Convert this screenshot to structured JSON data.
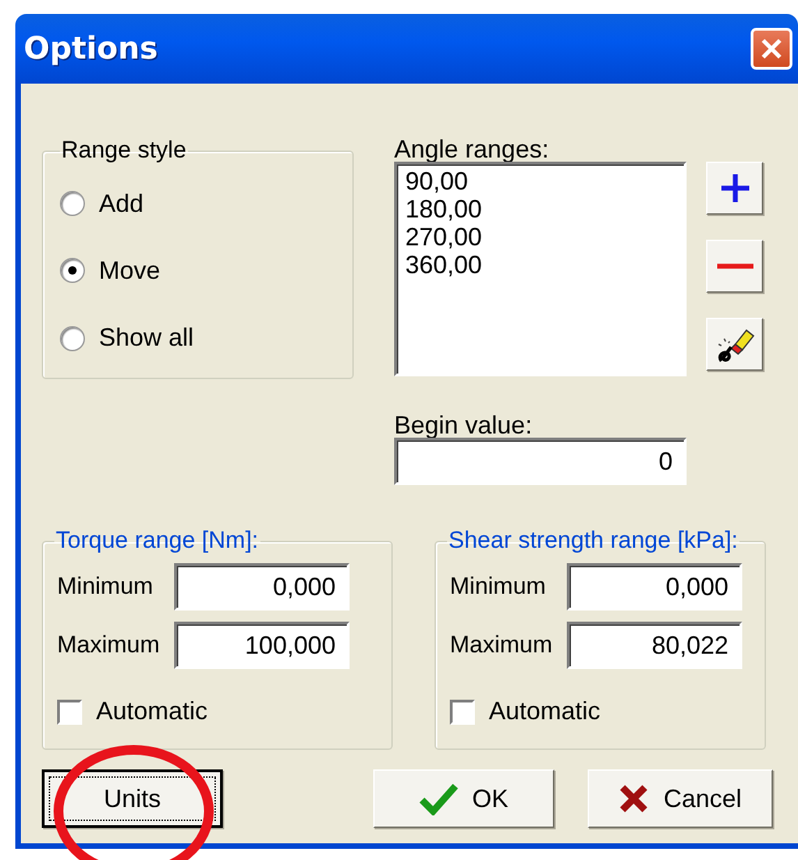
{
  "window": {
    "title": "Options"
  },
  "range_style": {
    "label": "Range style",
    "options": [
      {
        "label": "Add",
        "selected": false
      },
      {
        "label": "Move",
        "selected": true
      },
      {
        "label": "Show all",
        "selected": false
      }
    ]
  },
  "angle_ranges": {
    "label": "Angle ranges:",
    "items": [
      "90,00",
      "180,00",
      "270,00",
      "360,00"
    ]
  },
  "begin_value": {
    "label": "Begin value:",
    "value": "0"
  },
  "torque_range": {
    "label": "Torque range [Nm]:",
    "minimum": {
      "label": "Minimum",
      "value": "0,000"
    },
    "maximum": {
      "label": "Maximum",
      "value": "100,000"
    },
    "automatic": {
      "label": "Automatic",
      "checked": false
    }
  },
  "shear_strength_range": {
    "label": "Shear strength range [kPa]:",
    "minimum": {
      "label": "Minimum",
      "value": "0,000"
    },
    "maximum": {
      "label": "Maximum",
      "value": "80,022"
    },
    "automatic": {
      "label": "Automatic",
      "checked": false
    }
  },
  "buttons": [
    {
      "kind": "units",
      "label": "Units",
      "focused": true
    },
    {
      "kind": "ok",
      "label": "OK",
      "focused": false
    },
    {
      "kind": "cancel",
      "label": "Cancel",
      "focused": false
    }
  ]
}
